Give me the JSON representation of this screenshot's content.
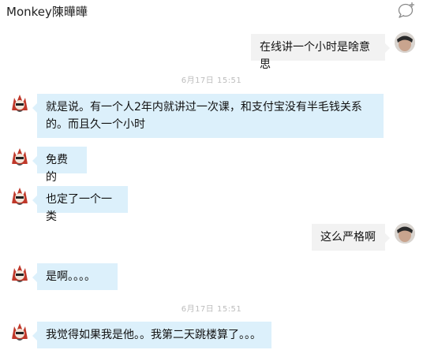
{
  "header": {
    "title": "Monkey陳曄曄"
  },
  "icons": {
    "new_chat": "chat-bubble-plus-icon"
  },
  "messages": [
    {
      "side": "right",
      "text": "在线讲一个小时是啥意思"
    },
    {
      "type": "timestamp",
      "text": "6月17日  15:51"
    },
    {
      "side": "left",
      "text": "就是说。有一个人2年内就讲过一次课，和支付宝没有半毛钱关系的。而且久一个小时"
    },
    {
      "side": "left",
      "text": "免费的"
    },
    {
      "side": "left",
      "text": "也定了一个一类"
    },
    {
      "side": "right",
      "text": "这么严格啊"
    },
    {
      "side": "left",
      "text": "是啊。。。。"
    },
    {
      "type": "timestamp",
      "text": "6月17日  15:51"
    },
    {
      "side": "left",
      "text": "我觉得如果我是他。。我第二天跳楼算了。。。"
    }
  ],
  "colors": {
    "incoming_bubble": "#dcf0fb",
    "outgoing_bubble": "#f2f2f2",
    "timestamp": "#bdbdbd"
  }
}
